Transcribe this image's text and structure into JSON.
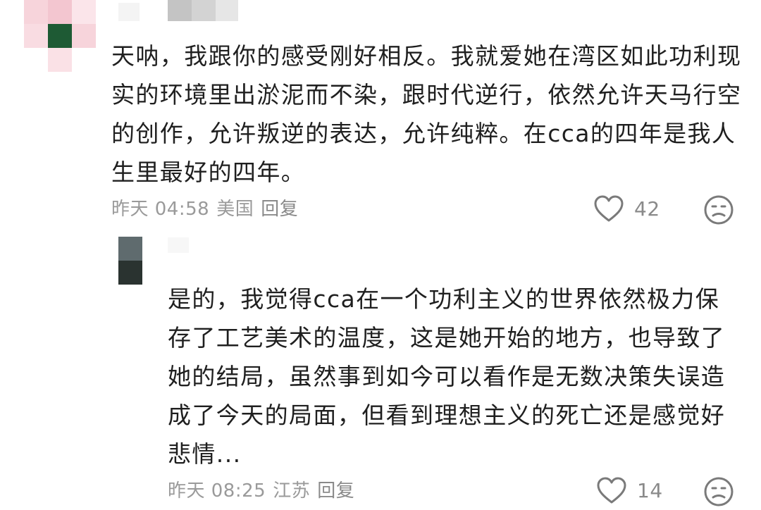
{
  "comments": [
    {
      "text": "天呐，我跟你的感受刚好相反。我就爱她在湾区如此功利现实的环境里出淤泥而不染，跟时代逆行，依然允许天马行空的创作，允许叛逆的表达，允许纯粹。在cca的四年是我人生里最好的四年。",
      "date": "昨天 04:58",
      "location": "美国",
      "reply_label": "回复",
      "likes": "42",
      "like_icon": "heart-outline-icon",
      "dislike_icon": "frown-face-icon"
    },
    {
      "text": "是的，我觉得cca在一个功利主义的世界依然极力保存了工艺美术的温度，这是她开始的地方，也导致了她的结局，虽然事到如今可以看作是无数决策失误造成了今天的局面，但看到理想主义的死亡还是感觉好悲情...",
      "date": "昨天 08:25",
      "location": "江苏",
      "reply_label": "回复",
      "likes": "14",
      "like_icon": "heart-outline-icon",
      "dislike_icon": "frown-face-icon"
    }
  ],
  "colors": {
    "text": "#1f1f1f",
    "meta": "#9a9a9a",
    "icon": "#7a7a7a",
    "avatar1_pink": "#f7d4db",
    "avatar1_green": "#1e5a34",
    "avatar2_slate": "#5f6b6e",
    "avatar2_dark": "#2a3330"
  }
}
